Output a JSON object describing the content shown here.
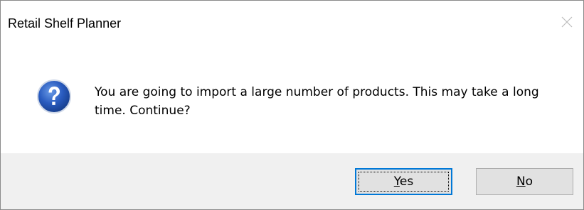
{
  "window": {
    "title": "Retail Shelf Planner"
  },
  "message": {
    "icon": "question-icon",
    "text": "You are going to import a large number of products. This may take a long time. Continue?"
  },
  "buttons": {
    "yes_label": "Yes",
    "no_label": "No",
    "yes_mnemonic": "Y",
    "no_mnemonic": "N"
  },
  "colors": {
    "button_strip": "#f0f0f0",
    "focus_border": "#0078d7",
    "icon_blue": "#1f4fa8"
  }
}
